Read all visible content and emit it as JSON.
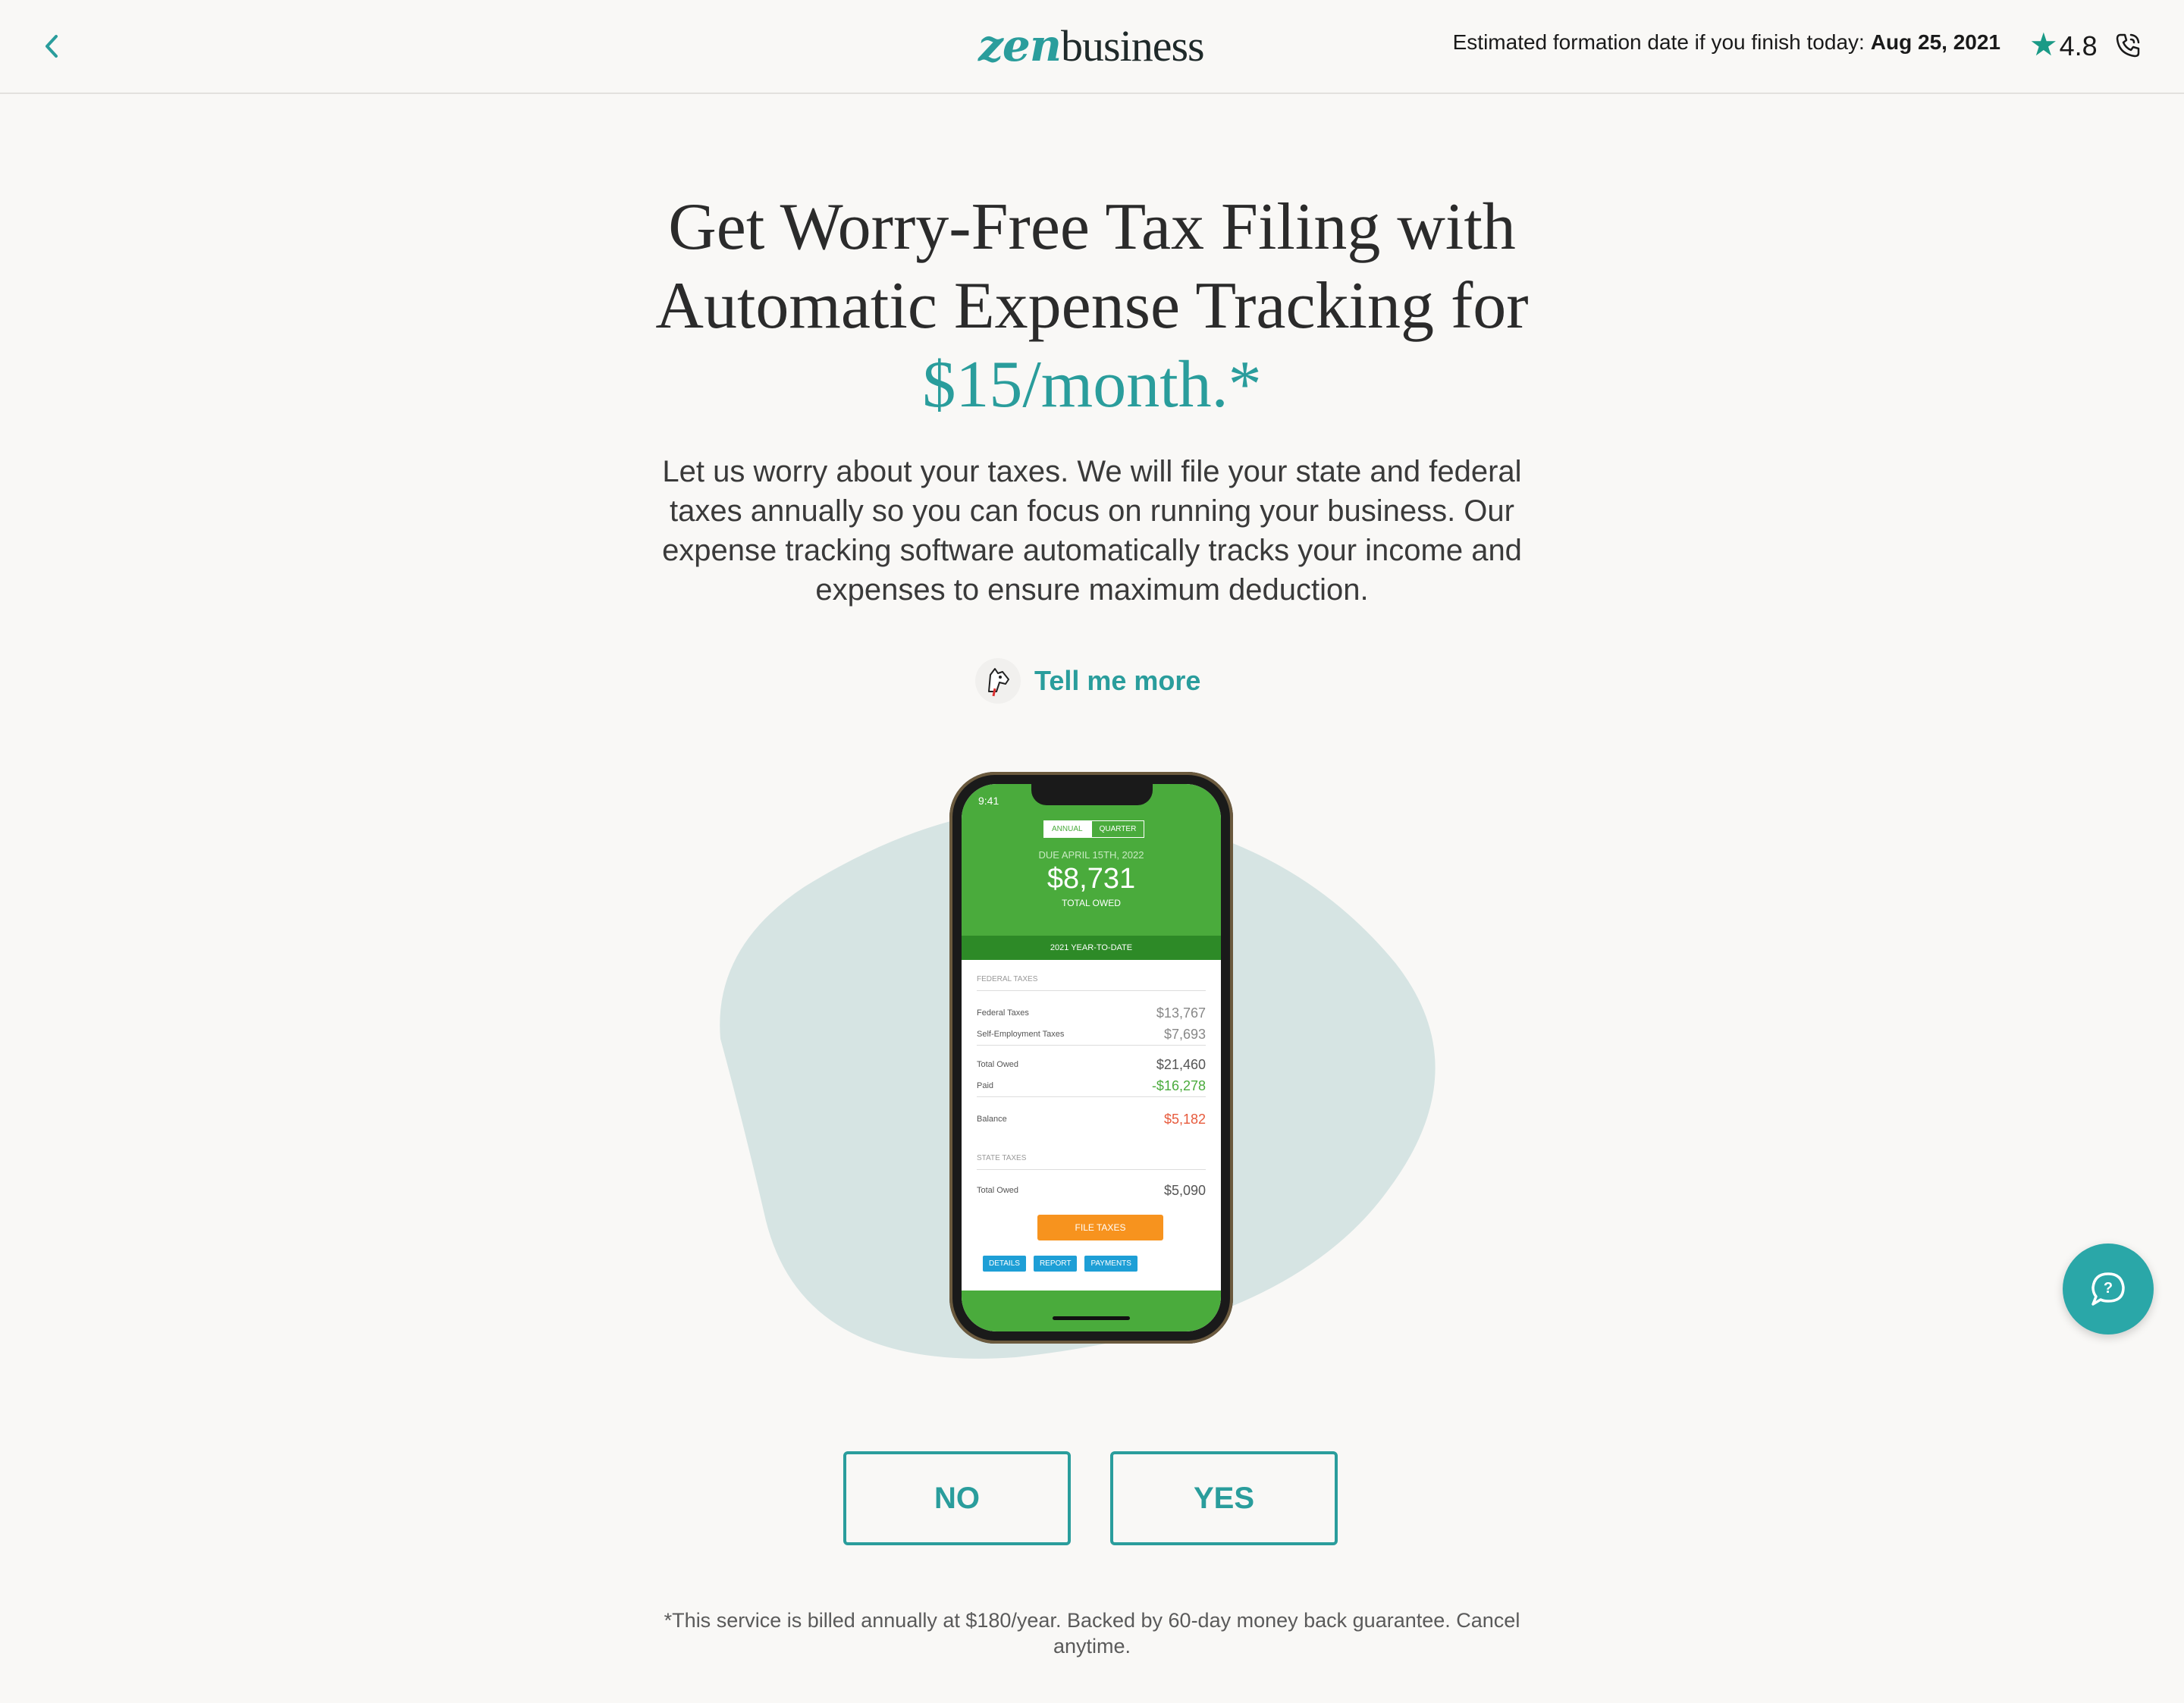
{
  "header": {
    "logo_zen": "zen",
    "logo_business": "business",
    "estimate_label": "Estimated formation date if you finish today:",
    "estimate_date": "Aug 25, 2021",
    "rating": "4.8"
  },
  "main": {
    "title_line1": "Get Worry-Free Tax Filing with",
    "title_line2": "Automatic Expense Tracking for",
    "title_price": "$15/month.*",
    "description": "Let us worry about your taxes. We will file your state and federal taxes annually so you can focus on running your business. Our expense tracking software automatically tracks your income and expenses to ensure maximum deduction.",
    "tell_more": "Tell me more"
  },
  "phone_screen": {
    "time": "9:41",
    "tab_annual": "ANNUAL",
    "tab_quarter": "QUARTER",
    "due": "DUE APRIL 15TH, 2022",
    "total": "$8,731",
    "total_label": "TOTAL OWED",
    "ytd": "2021 YEAR-TO-DATE",
    "federal_section": "FEDERAL TAXES",
    "federal_taxes_label": "Federal Taxes",
    "federal_taxes_value": "$13,767",
    "self_emp_label": "Self-Employment Taxes",
    "self_emp_value": "$7,693",
    "total_owed_label": "Total Owed",
    "total_owed_value": "$21,460",
    "paid_label": "Paid",
    "paid_value": "-$16,278",
    "balance_label": "Balance",
    "balance_value": "$5,182",
    "state_section": "STATE TAXES",
    "state_total_label": "Total Owed",
    "state_total_value": "$5,090",
    "file_taxes": "FILE TAXES",
    "btn_details": "DETAILS",
    "btn_report": "REPORT",
    "btn_payments": "PAYMENTS"
  },
  "actions": {
    "no_label": "NO",
    "yes_label": "YES"
  },
  "footer": {
    "note": "*This service is billed annually at $180/year. Backed by 60-day money back guarantee. Cancel anytime."
  },
  "colors": {
    "accent": "#2a9d9c",
    "background": "#f9f8f6",
    "blob": "#d6e4e3",
    "app_green": "#4aab3c"
  },
  "icons": {
    "back": "chevron-left-icon",
    "rating": "star-icon",
    "phone": "phone-icon",
    "chat": "help-chat-icon",
    "mascot": "dog-mascot-icon"
  }
}
